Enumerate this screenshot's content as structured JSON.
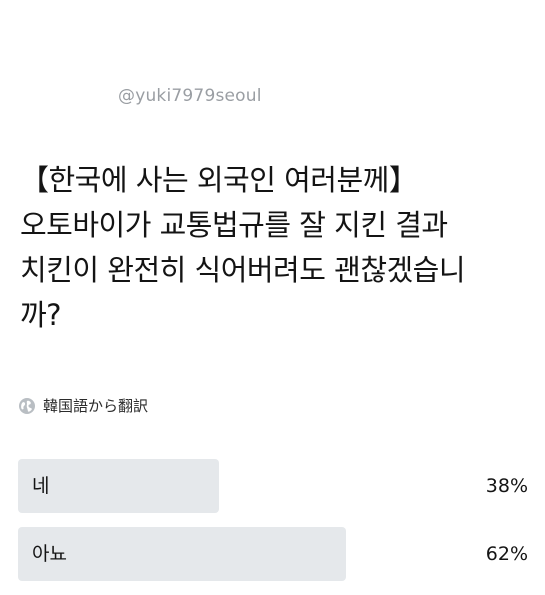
{
  "handle": "@yuki7979seoul",
  "question_lines": [
    "【한국에 사는 외국인 여러분께】",
    "오토바이가 교통법규를 잘 지킨 결과",
    "치킨이 완전히 식어버려도 괜찮겠습니",
    "까?"
  ],
  "translate": {
    "icon": "globe-icon",
    "label": "韓国語から翻訳"
  },
  "poll": {
    "options": [
      {
        "label": "네",
        "percent": "38%",
        "fraction": 0.38
      },
      {
        "label": "아뇨",
        "percent": "62%",
        "fraction": 0.62
      }
    ],
    "bar_color": "#e5e8eb"
  }
}
